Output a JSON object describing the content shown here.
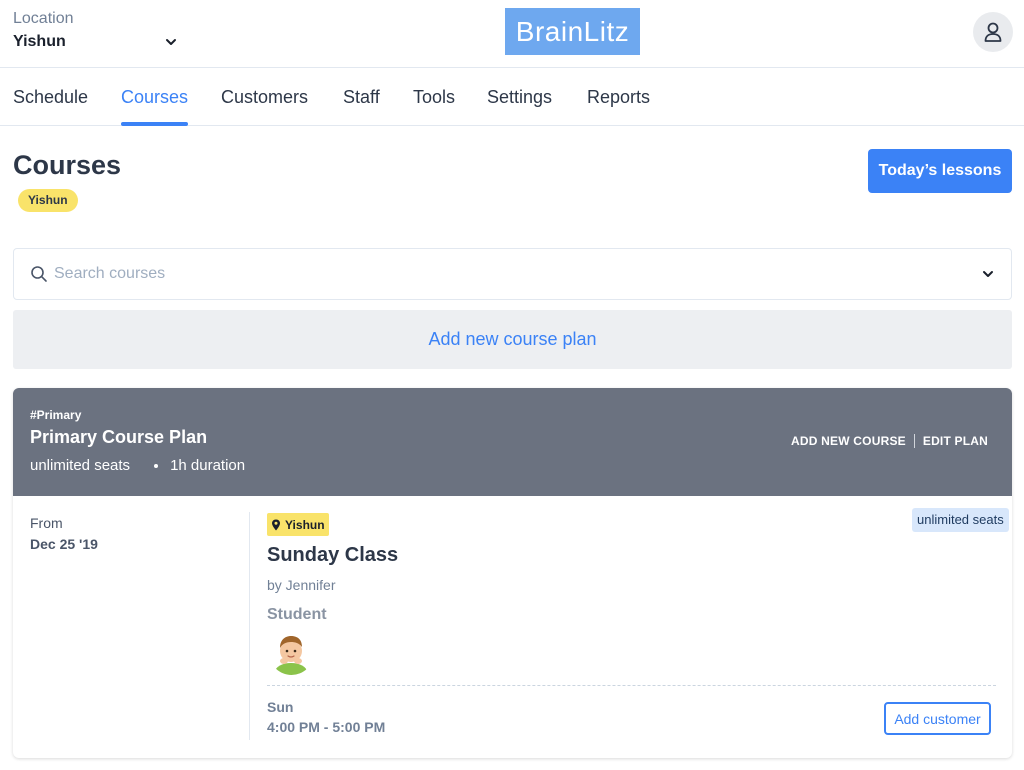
{
  "header": {
    "location_label": "Location",
    "location_value": "Yishun",
    "logo_text": "BrainLitz",
    "logo_color": "#6ea8ef"
  },
  "nav": {
    "tabs": [
      {
        "label": "Schedule",
        "active": false
      },
      {
        "label": "Courses",
        "active": true
      },
      {
        "label": "Customers",
        "active": false
      },
      {
        "label": "Staff",
        "active": false
      },
      {
        "label": "Tools",
        "active": false
      },
      {
        "label": "Settings",
        "active": false
      },
      {
        "label": "Reports",
        "active": false
      }
    ],
    "accent_color": "#3b82f6"
  },
  "page": {
    "title": "Courses",
    "location_badge": "Yishun",
    "today_button": "Today’s lessons"
  },
  "search": {
    "placeholder": "Search courses"
  },
  "add_plan_label": "Add new course plan",
  "plan": {
    "tag": "#Primary",
    "name": "Primary Course Plan",
    "seats": "unlimited seats",
    "duration": "1h duration",
    "add_course_label": "ADD NEW COURSE",
    "edit_plan_label": "EDIT PLAN",
    "header_color": "#6b7280",
    "course": {
      "from_label": "From",
      "from_date": "Dec 25 '19",
      "location": "Yishun",
      "seats_badge": "unlimited seats",
      "name": "Sunday Class",
      "teacher": "by Jennifer",
      "student_label": "Student",
      "day": "Sun",
      "time": "4:00 PM - 5:00 PM",
      "add_customer_label": "Add customer"
    }
  },
  "icons": {
    "chevron": "chevron-down-icon",
    "user": "user-icon",
    "search": "search-icon",
    "pin": "map-pin-icon"
  }
}
